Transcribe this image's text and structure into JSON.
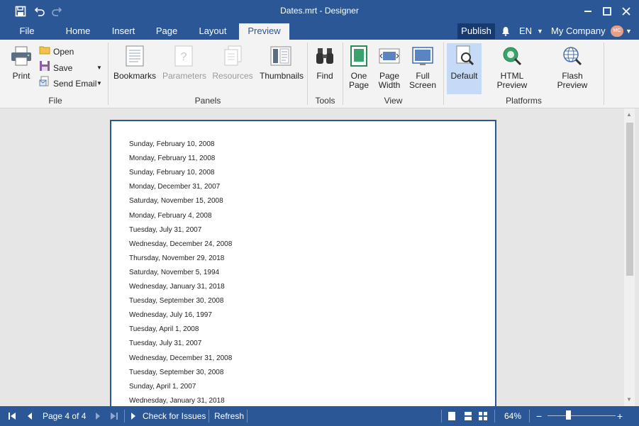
{
  "window": {
    "title": "Dates.mrt - Designer"
  },
  "tabs": [
    {
      "label": "File"
    },
    {
      "label": "Home"
    },
    {
      "label": "Insert"
    },
    {
      "label": "Page"
    },
    {
      "label": "Layout"
    },
    {
      "label": "Preview",
      "active": true
    }
  ],
  "header_right": {
    "publish": "Publish",
    "language": "EN",
    "company": "My Company",
    "avatar_initials": "MC"
  },
  "ribbon": {
    "file": {
      "print": "Print",
      "open": "Open",
      "save": "Save",
      "send_email": "Send Email",
      "group_label": "File"
    },
    "panels": {
      "bookmarks": "Bookmarks",
      "parameters": "Parameters",
      "resources": "Resources",
      "thumbnails": "Thumbnails",
      "group_label": "Panels"
    },
    "tools": {
      "find": "Find",
      "group_label": "Tools"
    },
    "view": {
      "one_page_1": "One",
      "one_page_2": "Page",
      "page_width_1": "Page",
      "page_width_2": "Width",
      "full_screen_1": "Full",
      "full_screen_2": "Screen",
      "group_label": "View"
    },
    "platforms": {
      "default": "Default",
      "html_preview": "HTML Preview",
      "flash_preview": "Flash Preview",
      "group_label": "Platforms"
    }
  },
  "report_rows": [
    "Sunday, February 10, 2008",
    "Monday, February 11, 2008",
    "Sunday, February 10, 2008",
    "Monday, December 31, 2007",
    "Saturday, November 15, 2008",
    "Monday, February 4, 2008",
    "Tuesday, July 31, 2007",
    "Wednesday, December 24, 2008",
    "Thursday, November 29, 2018",
    "Saturday, November 5, 1994",
    "Wednesday, January 31, 2018",
    "Tuesday, September 30, 2008",
    "Wednesday, July 16, 1997",
    "Tuesday, April 1, 2008",
    "Tuesday, July 31, 2007",
    "Wednesday, December 31, 2008",
    "Tuesday, September 30, 2008",
    "Sunday, April 1, 2007",
    "Wednesday, January 31, 2018"
  ],
  "status": {
    "page_text": "Page 4 of 4",
    "check_issues": "Check for Issues",
    "refresh": "Refresh",
    "zoom": "64%",
    "zoom_fraction": 0.3
  },
  "colors": {
    "accent": "#2b5797",
    "selected": "#c5daf6"
  }
}
